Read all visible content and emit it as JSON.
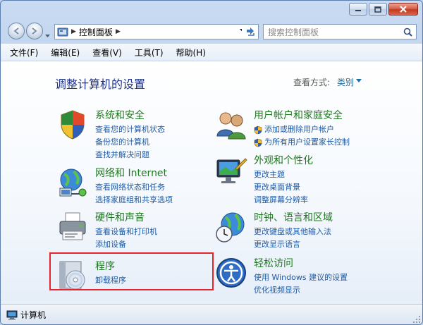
{
  "window": {
    "controls": {
      "minimize": "minimize-icon",
      "maximize": "maximize-icon",
      "close": "close-icon"
    }
  },
  "navbar": {
    "breadcrumb": "控制面板",
    "search_placeholder": "搜索控制面板"
  },
  "menu": [
    "文件(F)",
    "编辑(E)",
    "查看(V)",
    "工具(T)",
    "帮助(H)"
  ],
  "content": {
    "heading": "调整计算机的设置",
    "view_label": "查看方式:",
    "view_value": "类别"
  },
  "categories": [
    {
      "title": "系统和安全",
      "icon": "shield-icon",
      "links": [
        "查看您的计算机状态",
        "备份您的计算机",
        "查找并解决问题"
      ]
    },
    {
      "title": "网络和 Internet",
      "icon": "network-icon",
      "links": [
        "查看网络状态和任务",
        "选择家庭组和共享选项"
      ]
    },
    {
      "title": "硬件和声音",
      "icon": "printer-icon",
      "links": [
        "查看设备和打印机",
        "添加设备"
      ]
    },
    {
      "title": "程序",
      "icon": "programs-icon",
      "links": [
        "卸载程序"
      ]
    },
    {
      "title": "用户帐户和家庭安全",
      "icon": "users-icon",
      "links": [
        "添加或删除用户帐户",
        "为所有用户设置家长控制"
      ]
    },
    {
      "title": "外观和个性化",
      "icon": "display-icon",
      "links": [
        "更改主题",
        "更改桌面背景",
        "调整屏幕分辨率"
      ]
    },
    {
      "title": "时钟、语言和区域",
      "icon": "globe-clock-icon",
      "links": [
        "更改键盘或其他输入法",
        "更改显示语言"
      ]
    },
    {
      "title": "轻松访问",
      "icon": "ease-of-access-icon",
      "links": [
        "使用 Windows 建议的设置",
        "优化视频显示"
      ]
    }
  ],
  "status": {
    "text": "计算机"
  },
  "colors": {
    "heading": "#1e3287",
    "category_title": "#1e7a1e",
    "link": "#1c5aa6",
    "highlight": "#e8232b"
  }
}
